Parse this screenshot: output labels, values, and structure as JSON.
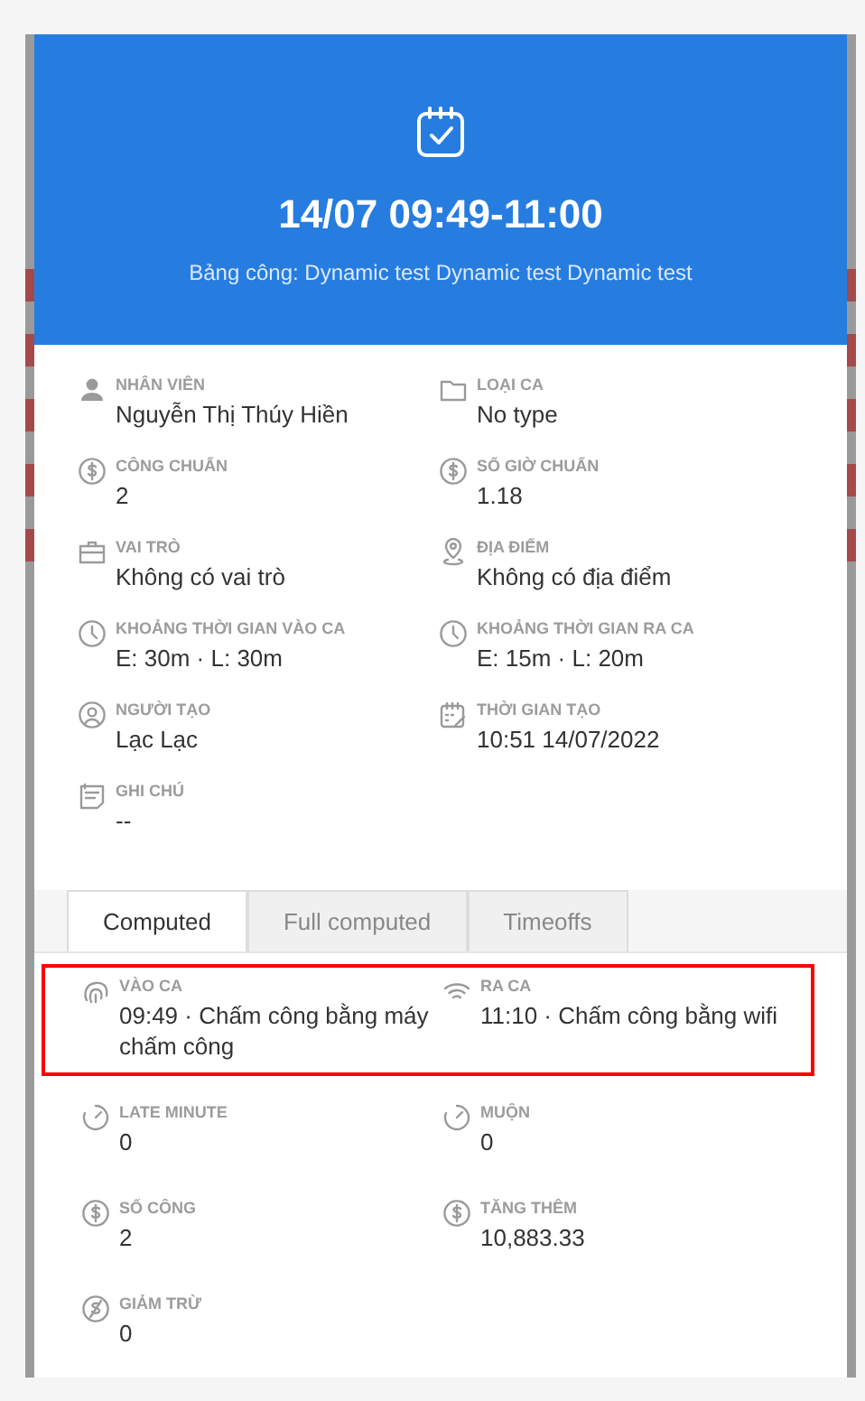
{
  "header": {
    "title": "14/07 09:49-11:00",
    "subtitle": "Bảng công: Dynamic test Dynamic test Dynamic test"
  },
  "details": [
    {
      "label": "NHÂN VIÊN",
      "value": "Nguyễn Thị Thúy Hiền"
    },
    {
      "label": "LOẠI CA",
      "value": "No type"
    },
    {
      "label": "CÔNG CHUẨN",
      "value": "2"
    },
    {
      "label": "SỐ GIỜ CHUẨN",
      "value": "1.18"
    },
    {
      "label": "VAI TRÒ",
      "value": "Không có vai trò"
    },
    {
      "label": "ĐỊA ĐIỂM",
      "value": "Không có địa điểm"
    },
    {
      "label": "KHOẢNG THỜI GIAN VÀO CA",
      "value": "E: 30m · L: 30m"
    },
    {
      "label": "KHOẢNG THỜI GIAN RA CA",
      "value": "E: 15m · L: 20m"
    },
    {
      "label": "NGƯỜI TẠO",
      "value": "Lạc Lạc"
    },
    {
      "label": "THỜI GIAN TẠO",
      "value": "10:51 14/07/2022"
    },
    {
      "label": "GHI CHÚ",
      "value": "--"
    }
  ],
  "tabs": [
    {
      "label": "Computed",
      "selected": true
    },
    {
      "label": "Full computed",
      "selected": false
    },
    {
      "label": "Timeoffs",
      "selected": false
    }
  ],
  "computed": [
    {
      "highlighted": true,
      "items": [
        {
          "label": "VÀO CA",
          "value": "09:49 · Chấm công bằng máy chấm công"
        },
        {
          "label": "RA CA",
          "value": "11:10 · Chấm công bằng wifi"
        }
      ]
    },
    {
      "highlighted": false,
      "items": [
        {
          "label": "LATE MINUTE",
          "value": "0"
        },
        {
          "label": "MUỘN",
          "value": "0"
        }
      ]
    },
    {
      "highlighted": false,
      "items": [
        {
          "label": "SỐ CÔNG",
          "value": "2"
        },
        {
          "label": "TĂNG THÊM",
          "value": "10,883.33"
        }
      ]
    },
    {
      "highlighted": false,
      "items": [
        {
          "label": "GIẢM TRỪ",
          "value": "0"
        }
      ]
    }
  ]
}
